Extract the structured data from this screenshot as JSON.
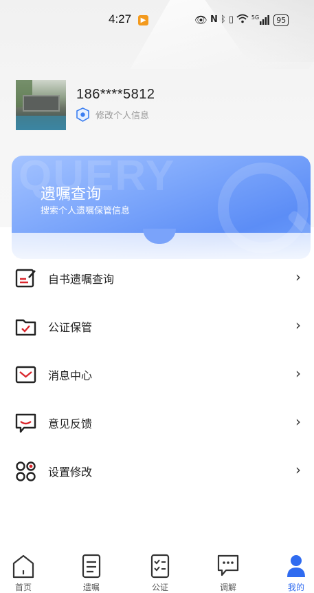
{
  "status_bar": {
    "time": "4:27",
    "battery": "95",
    "signal_text": "5G",
    "icons": [
      "eye-icon",
      "nfc-icon",
      "bluetooth-icon",
      "vibrate-icon",
      "wifi-icon",
      "signal-icon"
    ]
  },
  "profile": {
    "phone": "186****5812",
    "edit_label": "修改个人信息"
  },
  "banner": {
    "title": "遗嘱查询",
    "subtitle": "搜索个人遗嘱保管信息",
    "watermark": "QUERY",
    "colors": {
      "start": "#a4c3ff",
      "end": "#5c8df6"
    }
  },
  "menu": {
    "items": [
      {
        "label": "自书遗嘱查询",
        "icon": "document-edit-icon"
      },
      {
        "label": "公证保管",
        "icon": "folder-check-icon"
      },
      {
        "label": "消息中心",
        "icon": "mail-icon"
      },
      {
        "label": "意见反馈",
        "icon": "feedback-icon"
      },
      {
        "label": "设置修改",
        "icon": "settings-grid-icon"
      }
    ],
    "accent_color": "#d9262c"
  },
  "tabbar": {
    "tabs": [
      {
        "label": "首页",
        "icon": "home-icon"
      },
      {
        "label": "遗嘱",
        "icon": "document-icon"
      },
      {
        "label": "公证",
        "icon": "checklist-icon"
      },
      {
        "label": "调解",
        "icon": "chat-icon"
      },
      {
        "label": "我的",
        "icon": "user-icon"
      }
    ],
    "active_index": 4,
    "active_color": "#2f6bf0"
  }
}
